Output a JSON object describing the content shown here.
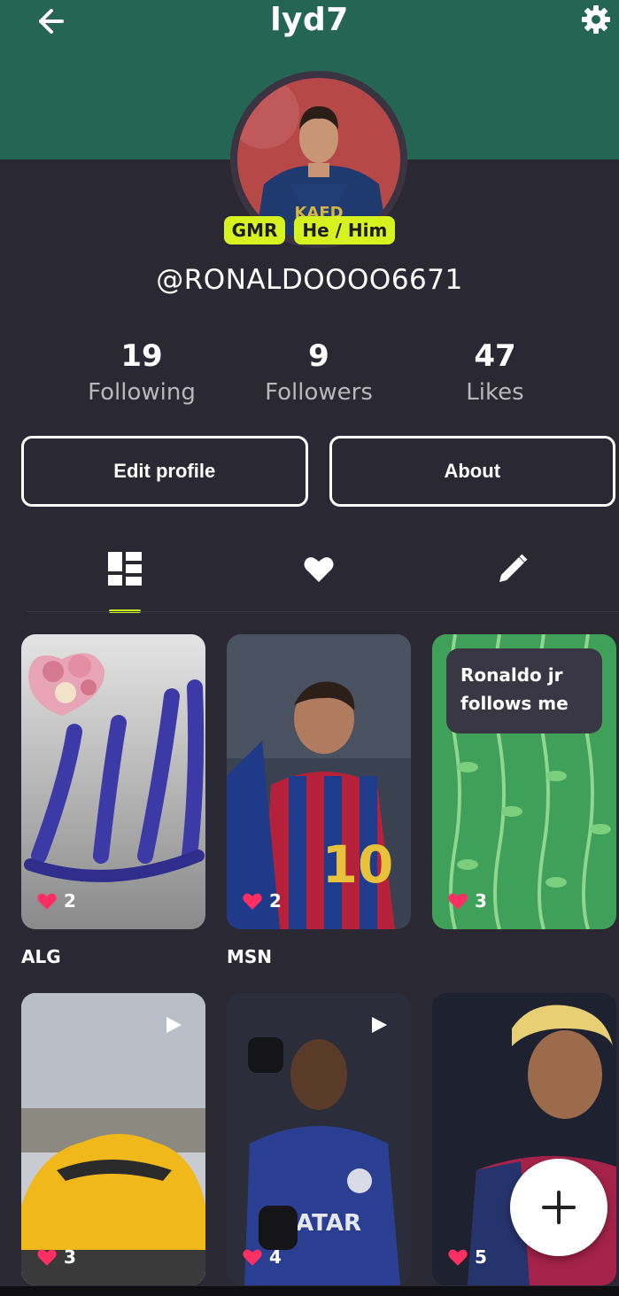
{
  "header": {
    "title": "lyd7",
    "back_icon": "arrow-left-icon",
    "settings_icon": "gear-icon",
    "band_color": "#256554"
  },
  "profile": {
    "badges": [
      "GMR",
      "He / Him"
    ],
    "handle": "@RONALDOOOO6671",
    "badge_color": "#d6f320"
  },
  "stats": [
    {
      "value": "19",
      "label": "Following"
    },
    {
      "value": "9",
      "label": "Followers"
    },
    {
      "value": "47",
      "label": "Likes"
    }
  ],
  "actions": {
    "edit_label": "Edit profile",
    "about_label": "About"
  },
  "tabs": {
    "items": [
      "grid-icon",
      "heart-icon",
      "pencil-icon"
    ],
    "active": 0,
    "accent": "#c9f01a"
  },
  "posts": [
    {
      "likes": "2",
      "caption": "ALG",
      "video": false
    },
    {
      "likes": "2",
      "caption": "MSN",
      "video": false
    },
    {
      "likes": "3",
      "caption": "",
      "video": false,
      "overlay_text": "Ronaldo jr follows me"
    },
    {
      "likes": "3",
      "caption": "",
      "video": true
    },
    {
      "likes": "4",
      "caption": "",
      "video": true
    },
    {
      "likes": "5",
      "caption": "",
      "video": false
    }
  ],
  "fab": {
    "icon": "plus-icon"
  }
}
